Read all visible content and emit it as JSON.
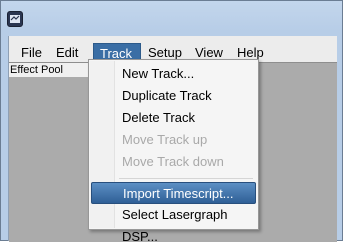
{
  "menubar": {
    "file": "File",
    "edit": "Edit",
    "track": "Track",
    "setup": "Setup",
    "view": "View",
    "help": "Help"
  },
  "panel": {
    "effect_pool": "Effect Pool"
  },
  "track_menu": {
    "items": [
      {
        "label": "New Track...",
        "enabled": true
      },
      {
        "label": "Duplicate Track",
        "enabled": true
      },
      {
        "label": "Delete Track",
        "enabled": true
      },
      {
        "label": "Move Track up",
        "enabled": false
      },
      {
        "label": "Move Track down",
        "enabled": false
      },
      {
        "label": "Import Timescript...",
        "enabled": true,
        "highlighted": true
      },
      {
        "label": "Select Lasergraph DSP...",
        "enabled": true
      }
    ]
  },
  "colors": {
    "highlight": "#3a6ea5",
    "disabled_text": "#a9a9a9"
  }
}
